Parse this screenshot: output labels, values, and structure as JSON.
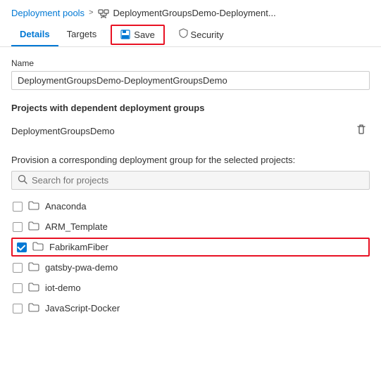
{
  "breadcrumb": {
    "link_label": "Deployment pools",
    "separator": "›",
    "icon": "deployment-groups-icon",
    "current": "DeploymentGroupsDemo-Deployment..."
  },
  "tabs": [
    {
      "id": "details",
      "label": "Details",
      "active": true
    },
    {
      "id": "targets",
      "label": "Targets",
      "active": false
    },
    {
      "id": "save",
      "label": "Save",
      "is_button": true
    },
    {
      "id": "security",
      "label": "Security",
      "active": false
    }
  ],
  "save_button": {
    "label": "Save"
  },
  "name_field": {
    "label": "Name",
    "value": "DeploymentGroupsDemo-DeploymentGroupsDemo"
  },
  "projects_section": {
    "title": "Projects with dependent deployment groups",
    "dependent_project": "DeploymentGroupsDemo"
  },
  "provision_section": {
    "label": "Provision a corresponding deployment group for the selected projects:",
    "search_placeholder": "Search for projects",
    "projects": [
      {
        "name": "Anaconda",
        "checked": false,
        "highlighted": false
      },
      {
        "name": "ARM_Template",
        "checked": false,
        "highlighted": false
      },
      {
        "name": "FabrikamFiber",
        "checked": true,
        "highlighted": true
      },
      {
        "name": "gatsby-pwa-demo",
        "checked": false,
        "highlighted": false
      },
      {
        "name": "iot-demo",
        "checked": false,
        "highlighted": false
      },
      {
        "name": "JavaScript-Docker",
        "checked": false,
        "highlighted": false
      }
    ]
  }
}
